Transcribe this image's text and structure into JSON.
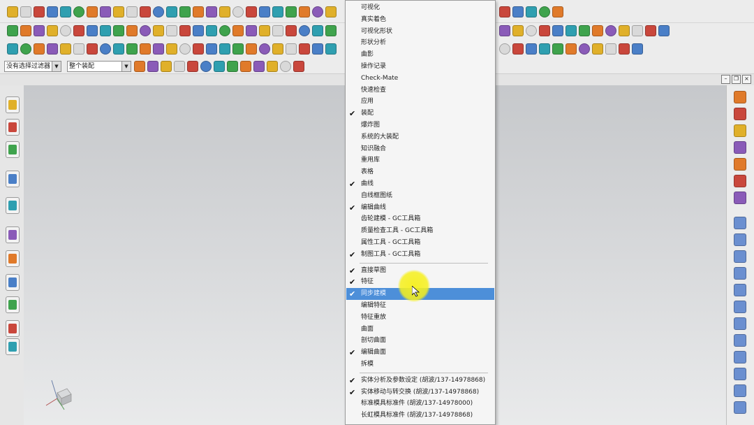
{
  "filter_bar": {
    "type_filter": "没有选择过滤器",
    "scope_filter": "整个装配"
  },
  "context_menu": {
    "items": [
      {
        "label": "可视化",
        "checked": false
      },
      {
        "label": "真实着色",
        "checked": false
      },
      {
        "label": "可视化形状",
        "checked": false
      },
      {
        "label": "形状分析",
        "checked": false
      },
      {
        "label": "曲影",
        "checked": false
      },
      {
        "label": "操作记录",
        "checked": false
      },
      {
        "label": "Check-Mate",
        "checked": false
      },
      {
        "label": "快速检查",
        "checked": false
      },
      {
        "label": "应用",
        "checked": false
      },
      {
        "label": "装配",
        "checked": true
      },
      {
        "label": "爆炸图",
        "checked": false
      },
      {
        "label": "系统的大装配",
        "checked": false
      },
      {
        "label": "知识融合",
        "checked": false
      },
      {
        "label": "重用库",
        "checked": false
      },
      {
        "label": "表格",
        "checked": false
      },
      {
        "label": "曲线",
        "checked": true
      },
      {
        "label": "自线框图纸",
        "checked": false
      },
      {
        "label": "编辑曲线",
        "checked": true
      },
      {
        "label": "齿轮建模 - GC工具箱",
        "checked": false
      },
      {
        "label": "质量检查工具 - GC工具箱",
        "checked": false
      },
      {
        "label": "属性工具 - GC工具箱",
        "checked": false
      },
      {
        "label": "制图工具 - GC工具箱",
        "checked": true
      },
      {
        "label": "直接草图",
        "checked": true
      },
      {
        "label": "特征",
        "checked": true
      },
      {
        "label": "同步建模",
        "checked": true,
        "highlighted": true
      },
      {
        "label": "编辑特征",
        "checked": false
      },
      {
        "label": "特征重放",
        "checked": false
      },
      {
        "label": "曲面",
        "checked": false
      },
      {
        "label": "剖切曲面",
        "checked": false
      },
      {
        "label": "编辑曲面",
        "checked": true
      },
      {
        "label": "拆模",
        "checked": false
      },
      {
        "label": "实体分析及参数设定 (胡波/137-14978868)",
        "checked": true
      },
      {
        "label": "实体移动与转交换 (胡波/137-14978868)",
        "checked": true
      },
      {
        "label": "标准模具标准件 (胡波/137-14978000)",
        "checked": false
      },
      {
        "label": "长虹模具标准件 (胡波/137-14978868)",
        "checked": false
      }
    ]
  },
  "icons": {
    "checkmark": "check-icon",
    "cursor": "mouse-pointer-icon",
    "view_triad": "wcs-axis-icon"
  },
  "colors": {
    "menu_highlight": "#4d8fd9",
    "cursor_halo": "#f6f01e",
    "graphics_top": "#c6c8cb",
    "graphics_bottom": "#e9eaeb"
  }
}
